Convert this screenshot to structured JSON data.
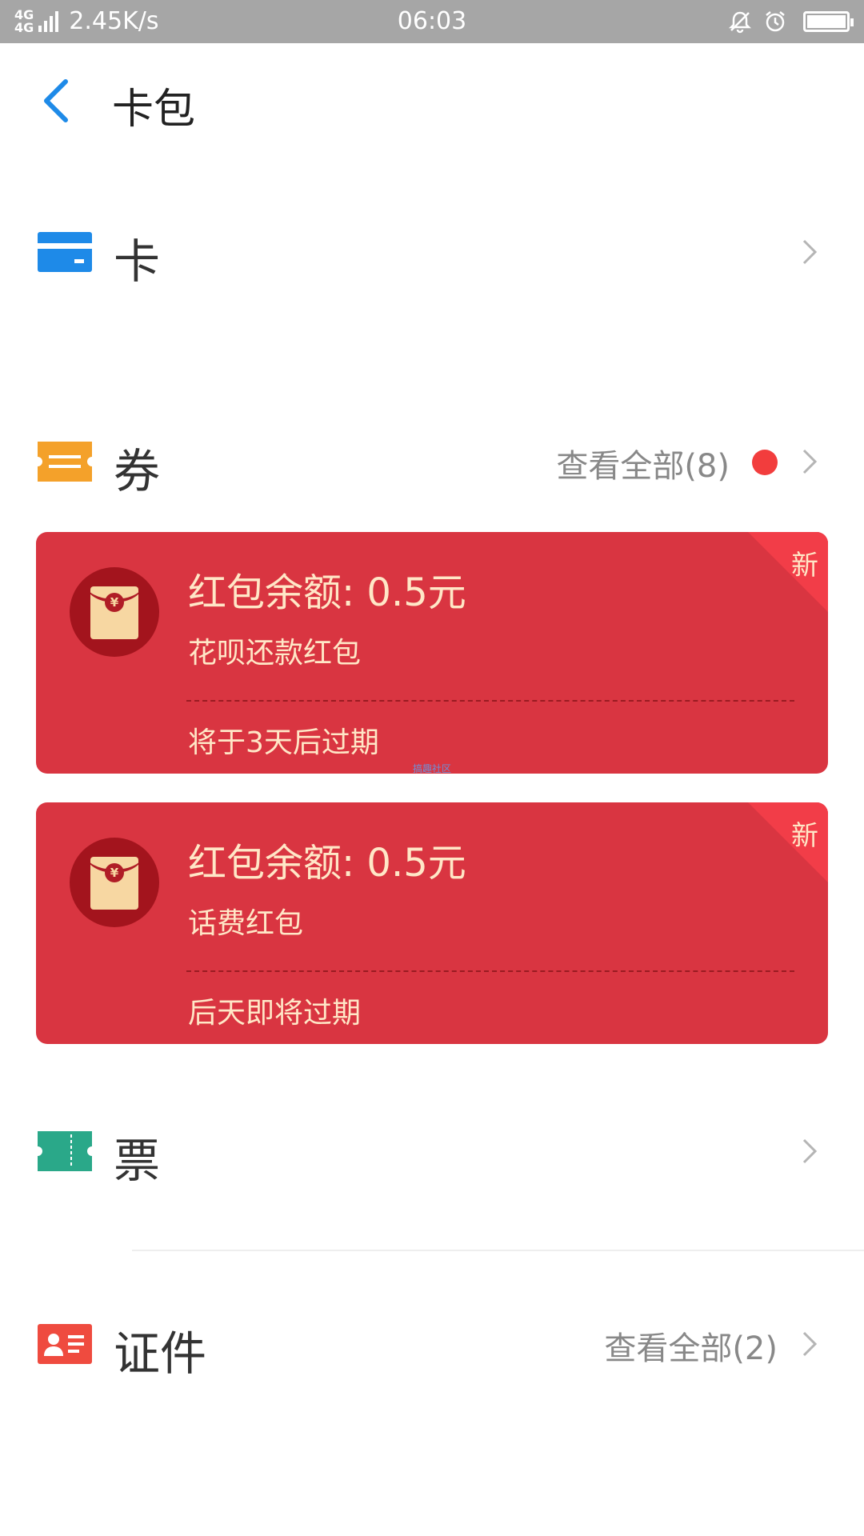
{
  "status_bar": {
    "network_top": "4G",
    "network_bottom": "4G",
    "speed": "2.45K/s",
    "time": "06:03"
  },
  "header": {
    "title": "卡包"
  },
  "sections": {
    "cards": {
      "label": "卡"
    },
    "coupons": {
      "label": "券",
      "view_all": "查看全部(8)"
    },
    "tickets": {
      "label": "票"
    },
    "ids": {
      "label": "证件",
      "view_all": "查看全部(2)"
    }
  },
  "coupon_cards": [
    {
      "badge": "新",
      "amount": "红包余额: 0.5元",
      "name": "花呗还款红包",
      "expiry": "将于3天后过期"
    },
    {
      "badge": "新",
      "amount": "红包余额: 0.5元",
      "name": "话费红包",
      "expiry": "后天即将过期"
    }
  ],
  "watermark": "搞趣社区",
  "colors": {
    "accent_blue": "#1e8ae8",
    "card_red": "#d93541",
    "coupon_orange": "#f4a12a",
    "ticket_teal": "#2aa889",
    "id_red": "#ef4b3f"
  }
}
